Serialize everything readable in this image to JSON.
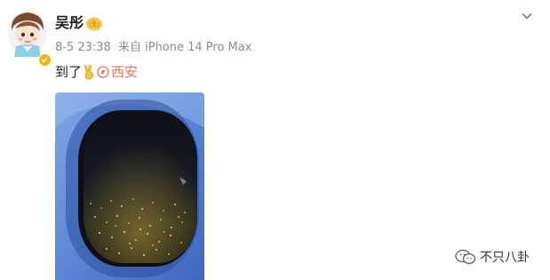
{
  "user": {
    "name": "吴彤",
    "avatar_icon": "chibi-avatar-icon",
    "badge_icon": "crown-badge-icon",
    "verified_color": "#f5b300"
  },
  "post": {
    "meta_time": "8-5 23:38",
    "meta_device": "来自 iPhone 14 Pro Max",
    "text": "到了",
    "emoji": "victory-hand-emoji",
    "location_icon": "location-icon",
    "location": "西安",
    "location_color": "#eb7350"
  },
  "menu": {
    "icon": "chevron-down-icon"
  },
  "watermark": {
    "text": "不只八卦",
    "icon": "wechat-icon"
  }
}
